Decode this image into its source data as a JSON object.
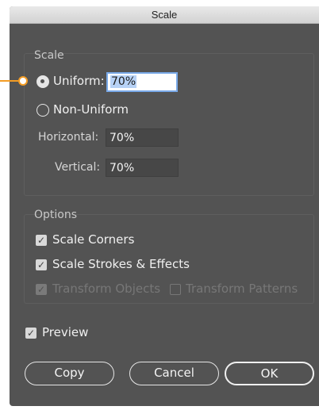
{
  "window": {
    "title": "Scale"
  },
  "scale_group": {
    "label": "Scale",
    "uniform": {
      "label": "Uniform:",
      "selected": true,
      "value": "70%"
    },
    "non_uniform": {
      "label": "Non-Uniform",
      "selected": false
    },
    "horizontal": {
      "label": "Horizontal:",
      "value": "70%"
    },
    "vertical": {
      "label": "Vertical:",
      "value": "70%"
    }
  },
  "options_group": {
    "label": "Options",
    "scale_corners": {
      "label": "Scale Corners",
      "checked": true
    },
    "scale_strokes": {
      "label": "Scale Strokes & Effects",
      "checked": true
    },
    "transform_objects": {
      "label": "Transform Objects",
      "checked": true,
      "enabled": false
    },
    "transform_patterns": {
      "label": "Transform Patterns",
      "checked": false,
      "enabled": false
    }
  },
  "preview": {
    "label": "Preview",
    "checked": true
  },
  "buttons": {
    "copy": "Copy",
    "cancel": "Cancel",
    "ok": "OK"
  },
  "colors": {
    "dialog_bg": "#535353",
    "titlebar": "#d9d9d9",
    "focus_ring": "#79a9e8",
    "callout": "#f39c25"
  }
}
